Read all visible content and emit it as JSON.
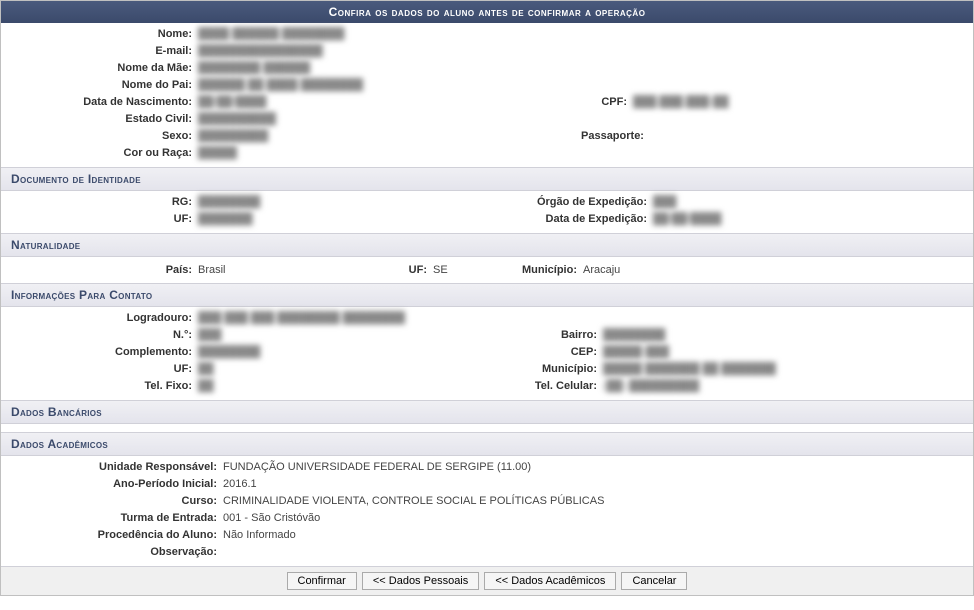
{
  "title": "Confira os dados do aluno antes de confirmar a operação",
  "personal": {
    "nome_label": "Nome:",
    "nome_value": "████ ██████ ████████",
    "email_label": "E-mail:",
    "email_value": "████████████████",
    "nome_mae_label": "Nome da Mãe:",
    "nome_mae_value": "████████ ██████",
    "nome_pai_label": "Nome do Pai:",
    "nome_pai_value": "██████ ██ ████ ████████",
    "nascimento_label": "Data de Nascimento:",
    "nascimento_value": "██/██/████",
    "cpf_label": "CPF:",
    "cpf_value": "███.███.███-██",
    "estado_civil_label": "Estado Civil:",
    "estado_civil_value": "██████████",
    "sexo_label": "Sexo:",
    "sexo_value": "█████████",
    "passaporte_label": "Passaporte:",
    "passaporte_value": "",
    "cor_label": "Cor ou Raça:",
    "cor_value": "█████"
  },
  "sections": {
    "documento": "Documento de Identidade",
    "naturalidade": "Naturalidade",
    "contato": "Informações Para Contato",
    "bancarios": "Dados Bancários",
    "academicos": "Dados Acadêmicos"
  },
  "documento": {
    "rg_label": "RG:",
    "rg_value": "████████",
    "orgao_label": "Órgão de Expedição:",
    "orgao_value": "███",
    "uf_label": "UF:",
    "uf_value": "███████",
    "data_exp_label": "Data de Expedição:",
    "data_exp_value": "██/██/████"
  },
  "naturalidade": {
    "pais_label": "País:",
    "pais_value": "Brasil",
    "uf_label": "UF:",
    "uf_value": "SE",
    "municipio_label": "Município:",
    "municipio_value": "Aracaju"
  },
  "contato": {
    "logradouro_label": "Logradouro:",
    "logradouro_value": "███  ███ ███ ████████ ████████",
    "numero_label": "N.°:",
    "numero_value": "███",
    "bairro_label": "Bairro:",
    "bairro_value": "████████",
    "complemento_label": "Complemento:",
    "complemento_value": "████████",
    "cep_label": "CEP:",
    "cep_value": "█████-███",
    "uf_label": "UF:",
    "uf_value": "██",
    "municipio_label": "Município:",
    "municipio_value": "█████ ███████ ██ ███████",
    "telfixo_label": "Tel. Fixo:",
    "telfixo_value": "██",
    "telcel_label": "Tel. Celular:",
    "telcel_value": "(██) █████████"
  },
  "academicos": {
    "unidade_label": "Unidade Responsável:",
    "unidade_value": "FUNDAÇÃO UNIVERSIDADE FEDERAL DE SERGIPE (11.00)",
    "ano_label": "Ano-Período Inicial:",
    "ano_value": "2016.1",
    "curso_label": "Curso:",
    "curso_value": "CRIMINALIDADE VIOLENTA, CONTROLE SOCIAL E POLÍTICAS PÚBLICAS",
    "turma_label": "Turma de Entrada:",
    "turma_value": "001 - São Cristóvão",
    "procedencia_label": "Procedência do Aluno:",
    "procedencia_value": "Não Informado",
    "observacao_label": "Observação:",
    "observacao_value": ""
  },
  "buttons": {
    "confirmar": "Confirmar",
    "dados_pessoais": "<< Dados Pessoais",
    "dados_academicos": "<< Dados Acadêmicos",
    "cancelar": "Cancelar"
  }
}
